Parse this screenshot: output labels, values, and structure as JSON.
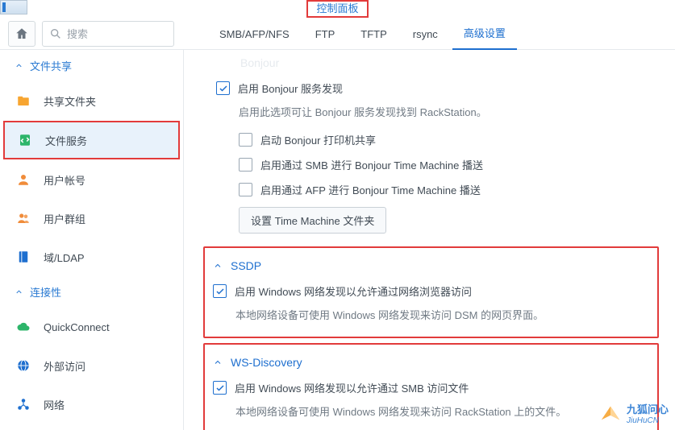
{
  "window": {
    "title": "控制面板"
  },
  "search": {
    "placeholder": "搜索"
  },
  "tabs": {
    "items": [
      "SMB/AFP/NFS",
      "FTP",
      "TFTP",
      "rsync",
      "高级设置"
    ],
    "active": 4
  },
  "sidebar": {
    "sections": [
      {
        "title": "文件共享",
        "items": [
          {
            "label": "共享文件夹",
            "icon": "folder",
            "color": "#f7a531"
          },
          {
            "label": "文件服务",
            "icon": "file-transfer",
            "color": "#2db56a",
            "active": true,
            "highlight": true
          },
          {
            "label": "用户帐号",
            "icon": "user",
            "color": "#f08c3a"
          },
          {
            "label": "用户群组",
            "icon": "users",
            "color": "#f08c3a"
          },
          {
            "label": "域/LDAP",
            "icon": "book",
            "color": "#1e6fcf"
          }
        ]
      },
      {
        "title": "连接性",
        "items": [
          {
            "label": "QuickConnect",
            "icon": "cloud-link",
            "color": "#2db56a"
          },
          {
            "label": "外部访问",
            "icon": "globe",
            "color": "#1e6fcf"
          },
          {
            "label": "网络",
            "icon": "network",
            "color": "#1e6fcf"
          }
        ]
      }
    ]
  },
  "content": {
    "bonjour": {
      "title_faded": "Bonjour",
      "enable": {
        "label": "启用 Bonjour 服务发现",
        "checked": true
      },
      "desc": "启用此选项可让 Bonjour 服务发现找到 RackStation。",
      "printer": {
        "label": "启动 Bonjour 打印机共享",
        "checked": false
      },
      "smb_tm": {
        "label": "启用通过 SMB 进行 Bonjour Time Machine 播送",
        "checked": false
      },
      "afp_tm": {
        "label": "启用通过 AFP 进行 Bonjour Time Machine 播送",
        "checked": false
      },
      "tm_btn": "设置 Time Machine 文件夹"
    },
    "ssdp": {
      "title": "SSDP",
      "enable": {
        "label": "启用 Windows 网络发现以允许通过网络浏览器访问",
        "checked": true
      },
      "desc": "本地网络设备可使用 Windows 网络发现来访问 DSM 的网页界面。"
    },
    "wsd": {
      "title": "WS-Discovery",
      "enable": {
        "label": "启用 Windows 网络发现以允许通过 SMB 访问文件",
        "checked": true
      },
      "desc": "本地网络设备可使用 Windows 网络发现来访问 RackStation 上的文件。"
    }
  },
  "watermark": {
    "line1": "九狐问心",
    "line2": "JiuHuCN"
  }
}
